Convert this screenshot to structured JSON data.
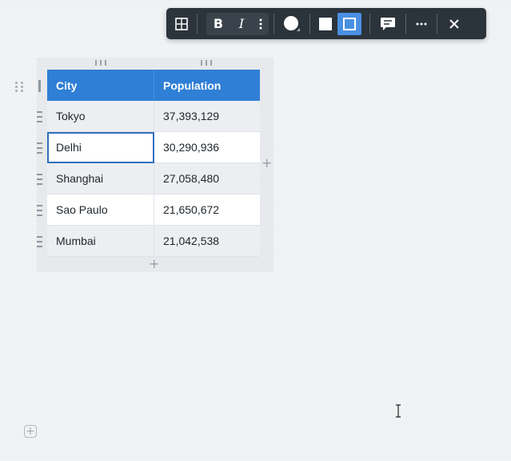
{
  "toolbar": {
    "table_icon": "table-grid-icon",
    "bold_label": "B",
    "italic_label": "I",
    "more_format_icon": "vertical-ellipsis-icon",
    "text_color_icon": "circle-color-icon",
    "background_fill_icon": "square-fill-icon",
    "border_icon": "square-border-icon",
    "comment_icon": "comment-icon",
    "more_icon": "horizontal-ellipsis-icon",
    "close_icon": "close-icon",
    "active_color": "#4a90e2"
  },
  "table": {
    "headers": [
      "City",
      "Population"
    ],
    "rows": [
      {
        "city": "Tokyo",
        "population": "37,393,129"
      },
      {
        "city": "Delhi",
        "population": "30,290,936"
      },
      {
        "city": "Shanghai",
        "population": "27,058,480"
      },
      {
        "city": "Sao Paulo",
        "population": "21,650,672"
      },
      {
        "city": "Mumbai",
        "population": "21,042,538"
      }
    ],
    "header_color": "#2f7fd6",
    "add_row_label": "+",
    "add_column_label": "+"
  },
  "editor": {
    "add_block_label": "+"
  }
}
